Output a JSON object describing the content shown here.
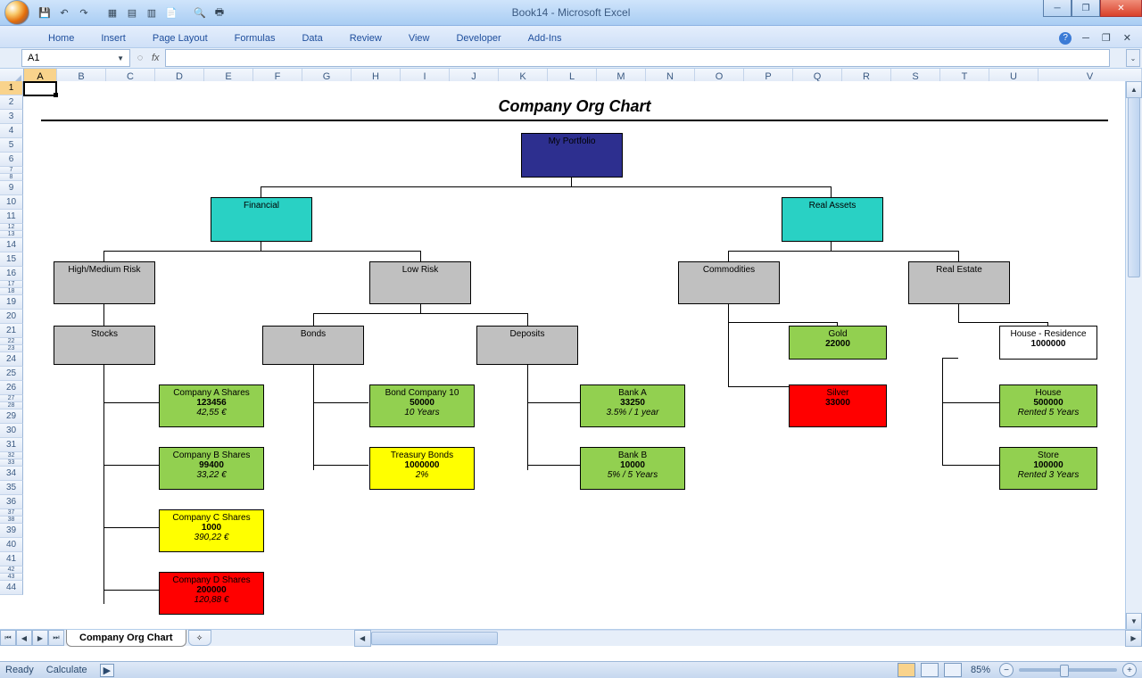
{
  "app_title": "Book14 - Microsoft Excel",
  "ribbon_tabs": [
    "Home",
    "Insert",
    "Page Layout",
    "Formulas",
    "Data",
    "Review",
    "View",
    "Developer",
    "Add-Ins"
  ],
  "namebox": "A1",
  "fx": "fx",
  "columns": [
    "A",
    "B",
    "C",
    "D",
    "E",
    "F",
    "G",
    "H",
    "I",
    "J",
    "K",
    "L",
    "M",
    "N",
    "O",
    "P",
    "Q",
    "R",
    "S",
    "T",
    "U",
    "V"
  ],
  "rows_main": [
    1,
    2,
    3,
    4,
    5,
    6,
    9,
    10,
    11,
    14,
    15,
    16,
    19,
    20,
    21,
    24,
    25,
    26,
    29,
    30,
    31,
    34,
    35,
    36,
    39,
    40,
    41,
    44
  ],
  "rows_short": [
    "7",
    "8",
    "12",
    "13",
    "17",
    "18",
    "22",
    "23",
    "27",
    "28",
    "32",
    "33",
    "37",
    "38",
    "42",
    "43"
  ],
  "sheet_tab": "Company Org Chart",
  "status": {
    "left1": "Ready",
    "left2": "Calculate",
    "zoom": "85%"
  },
  "org_title": "Company Org Chart",
  "nodes": {
    "root": {
      "name": "My Portfolio"
    },
    "financial": {
      "name": "Financial"
    },
    "realassets": {
      "name": "Real Assets"
    },
    "highmed": {
      "name": "High/Medium Risk"
    },
    "lowrisk": {
      "name": "Low Risk"
    },
    "commod": {
      "name": "Commodities"
    },
    "realestate": {
      "name": "Real Estate"
    },
    "stocks": {
      "name": "Stocks"
    },
    "bonds": {
      "name": "Bonds"
    },
    "deposits": {
      "name": "Deposits"
    },
    "gold": {
      "name": "Gold",
      "v1": "22000"
    },
    "houseres": {
      "name": "House - Residence",
      "v1": "1000000"
    },
    "compA": {
      "name": "Company A Shares",
      "v1": "123456",
      "v2": "42,55 €"
    },
    "bond10": {
      "name": "Bond Company 10",
      "v1": "50000",
      "v2": "10 Years"
    },
    "bankA": {
      "name": "Bank A",
      "v1": "33250",
      "v2": "3.5% / 1 year"
    },
    "silver": {
      "name": "Silver",
      "v1": "33000"
    },
    "house": {
      "name": "House",
      "v1": "500000",
      "v2": "Rented 5 Years"
    },
    "compB": {
      "name": "Company B Shares",
      "v1": "99400",
      "v2": "33,22 €"
    },
    "treas": {
      "name": "Treasury Bonds",
      "v1": "1000000",
      "v2": "2%"
    },
    "bankB": {
      "name": "Bank B",
      "v1": "10000",
      "v2": "5% / 5 Years"
    },
    "store": {
      "name": "Store",
      "v1": "100000",
      "v2": "Rented 3 Years"
    },
    "compC": {
      "name": "Company C Shares",
      "v1": "1000",
      "v2": "390,22 €"
    },
    "compD": {
      "name": "Company D Shares",
      "v1": "200000",
      "v2": "120,88 €"
    }
  },
  "chart_data": {
    "type": "tree",
    "title": "Company Org Chart",
    "tree": {
      "name": "My Portfolio",
      "children": [
        {
          "name": "Financial",
          "children": [
            {
              "name": "High/Medium Risk",
              "children": [
                {
                  "name": "Stocks",
                  "children": [
                    {
                      "name": "Company A Shares",
                      "value": 123456,
                      "detail": "42,55 €"
                    },
                    {
                      "name": "Company B Shares",
                      "value": 99400,
                      "detail": "33,22 €"
                    },
                    {
                      "name": "Company C Shares",
                      "value": 1000,
                      "detail": "390,22 €"
                    },
                    {
                      "name": "Company D Shares",
                      "value": 200000,
                      "detail": "120,88 €"
                    }
                  ]
                }
              ]
            },
            {
              "name": "Low Risk",
              "children": [
                {
                  "name": "Bonds",
                  "children": [
                    {
                      "name": "Bond Company 10",
                      "value": 50000,
                      "detail": "10 Years"
                    },
                    {
                      "name": "Treasury Bonds",
                      "value": 1000000,
                      "detail": "2%"
                    }
                  ]
                },
                {
                  "name": "Deposits",
                  "children": [
                    {
                      "name": "Bank A",
                      "value": 33250,
                      "detail": "3.5% / 1 year"
                    },
                    {
                      "name": "Bank B",
                      "value": 10000,
                      "detail": "5% / 5 Years"
                    }
                  ]
                }
              ]
            }
          ]
        },
        {
          "name": "Real Assets",
          "children": [
            {
              "name": "Commodities",
              "children": [
                {
                  "name": "Gold",
                  "value": 22000
                },
                {
                  "name": "Silver",
                  "value": 33000
                }
              ]
            },
            {
              "name": "Real Estate",
              "children": [
                {
                  "name": "House - Residence",
                  "value": 1000000
                },
                {
                  "name": "House",
                  "value": 500000,
                  "detail": "Rented 5 Years"
                },
                {
                  "name": "Store",
                  "value": 100000,
                  "detail": "Rented 3 Years"
                }
              ]
            }
          ]
        }
      ]
    }
  }
}
